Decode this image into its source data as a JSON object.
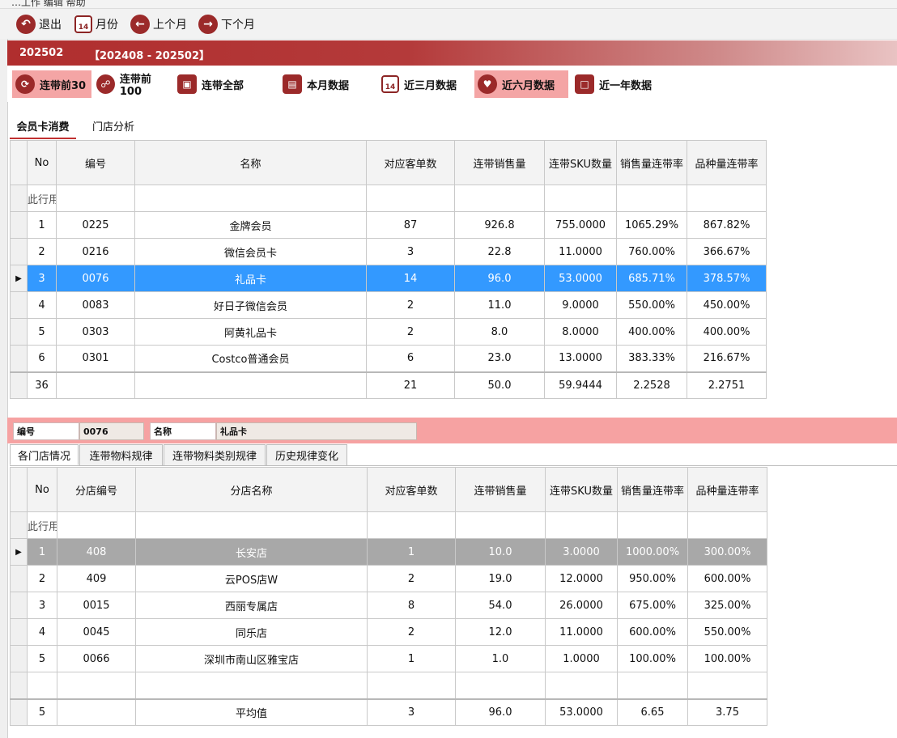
{
  "menu": {
    "text": "…工作  编辑  帮助"
  },
  "toolbar": [
    {
      "label": "退出",
      "icon": "exit-icon"
    },
    {
      "label": "月份",
      "icon": "calendar-icon",
      "badge": "14"
    },
    {
      "label": "上个月",
      "icon": "arrow-left-icon"
    },
    {
      "label": "下个月",
      "icon": "arrow-right-icon"
    }
  ],
  "banner": {
    "current": "202502",
    "range": "【202408 - 202502】"
  },
  "range_buttons": [
    {
      "label": "连带前30",
      "icon": "share-icon",
      "active": true
    },
    {
      "label": "连带前100",
      "icon": "link-icon",
      "active": false
    },
    {
      "label": "连带全部",
      "icon": "chart-icon",
      "active": false
    },
    {
      "label": "本月数据",
      "icon": "document-icon",
      "active": false
    },
    {
      "label": "近三月数据",
      "icon": "calendar-icon",
      "badge": "14",
      "active": false
    },
    {
      "label": "近六月数据",
      "icon": "heart-icon",
      "active": true
    },
    {
      "label": "近一年数据",
      "icon": "screen-icon",
      "active": false
    }
  ],
  "main_tabs": [
    "会员卡消费",
    "门店分析"
  ],
  "table1": {
    "columns": [
      "No",
      "编号",
      "名称",
      "对应客单数",
      "连带销售量",
      "连带SKU数量",
      "销售量连带率",
      "品种量连带率"
    ],
    "filter_text": "此行用",
    "rows": [
      [
        "1",
        "0225",
        "金牌会员",
        "87",
        "926.8",
        "755.0000",
        "1065.29%",
        "867.82%"
      ],
      [
        "2",
        "0216",
        "微信会员卡",
        "3",
        "22.8",
        "11.0000",
        "760.00%",
        "366.67%"
      ],
      [
        "3",
        "0076",
        "礼品卡",
        "14",
        "96.0",
        "53.0000",
        "685.71%",
        "378.57%"
      ],
      [
        "4",
        "0083",
        "好日子微信会员",
        "2",
        "11.0",
        "9.0000",
        "550.00%",
        "450.00%"
      ],
      [
        "5",
        "0303",
        "阿黄礼品卡",
        "2",
        "8.0",
        "8.0000",
        "400.00%",
        "400.00%"
      ],
      [
        "6",
        "0301",
        "Costco普通会员",
        "6",
        "23.0",
        "13.0000",
        "383.33%",
        "216.67%"
      ]
    ],
    "selected_row": 2,
    "footer": [
      "36",
      "",
      "",
      "21",
      "50.0",
      "59.9444",
      "2.2528",
      "2.2751"
    ]
  },
  "detail": {
    "code_label": "编号",
    "code_value": "0076",
    "name_label": "名称",
    "name_value": "礼品卡"
  },
  "sub_tabs": [
    "各门店情况",
    "连带物料规律",
    "连带物料类别规律",
    "历史规律变化"
  ],
  "table2": {
    "columns": [
      "No",
      "分店编号",
      "分店名称",
      "对应客单数",
      "连带销售量",
      "连带SKU数量",
      "销售量连带率",
      "品种量连带率"
    ],
    "filter_text": "此行用",
    "rows": [
      [
        "1",
        "408",
        "长安店",
        "1",
        "10.0",
        "3.0000",
        "1000.00%",
        "300.00%"
      ],
      [
        "2",
        "409",
        "云POS店W",
        "2",
        "19.0",
        "12.0000",
        "950.00%",
        "600.00%"
      ],
      [
        "3",
        "0015",
        "西丽专属店",
        "8",
        "54.0",
        "26.0000",
        "675.00%",
        "325.00%"
      ],
      [
        "4",
        "0045",
        "同乐店",
        "2",
        "12.0",
        "11.0000",
        "600.00%",
        "550.00%"
      ],
      [
        "5",
        "0066",
        "深圳市南山区雅宝店",
        "1",
        "1.0",
        "1.0000",
        "100.00%",
        "100.00%"
      ]
    ],
    "selected_row": 0,
    "footer": [
      "5",
      "",
      "平均值",
      "3",
      "96.0",
      "53.0000",
      "6.65",
      "3.75"
    ]
  },
  "colors": {
    "brand": "#9b2a2a",
    "banner": "#b02e2e",
    "selected_blue": "#3399ff",
    "selected_gray": "#a8a8a8",
    "active_button": "#f4a5a5",
    "pink_bar": "#f6a2a2"
  }
}
